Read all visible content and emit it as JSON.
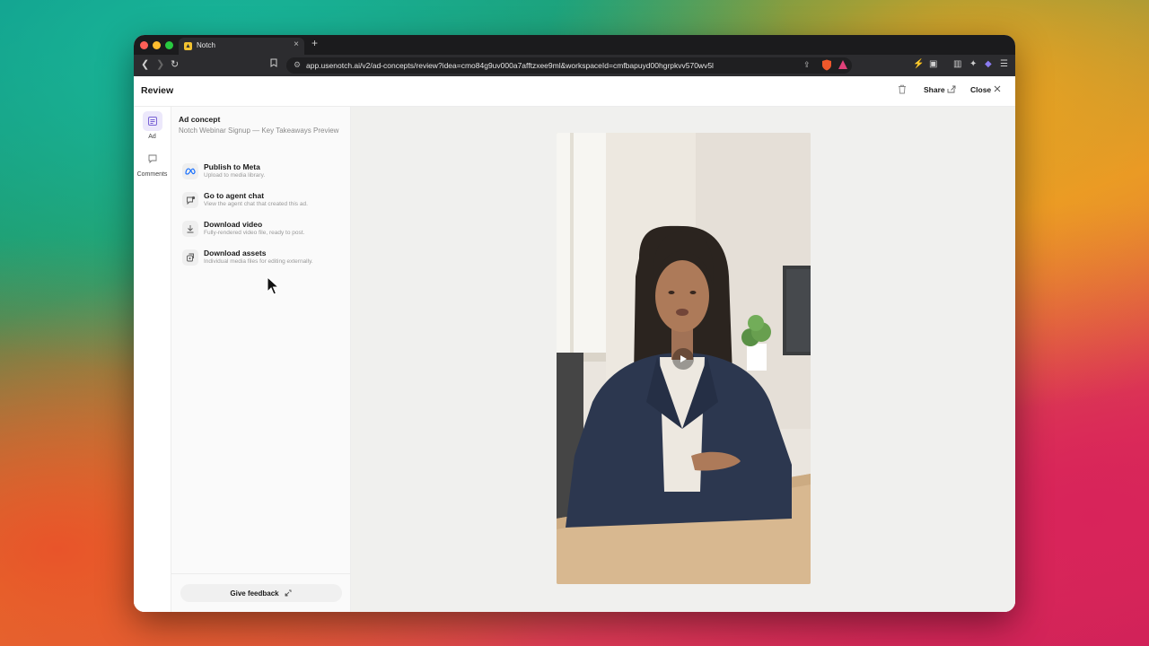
{
  "browser": {
    "tab_title": "Notch",
    "tab_close": "×",
    "new_tab": "+",
    "url": "app.usenotch.ai/v2/ad-concepts/review?idea=cmo84g9uv000a7afftzxee9ml&workspaceId=cmfbapuyd00hgrpkvv570wv5l"
  },
  "header": {
    "title": "Review",
    "share_label": "Share",
    "close_label": "Close"
  },
  "rail": {
    "items": [
      {
        "label": "Ad"
      },
      {
        "label": "Comments"
      }
    ]
  },
  "panel": {
    "concept_label": "Ad concept",
    "concept_name": "Notch Webinar Signup — Key Takeaways Preview",
    "actions": [
      {
        "title": "Publish to Meta",
        "subtitle": "Upload to media library."
      },
      {
        "title": "Go to agent chat",
        "subtitle": "View the agent chat that created this ad."
      },
      {
        "title": "Download video",
        "subtitle": "Fully-rendered video file, ready to post."
      },
      {
        "title": "Download assets",
        "subtitle": "Individual media files for editing externally."
      }
    ],
    "feedback_label": "Give feedback"
  },
  "colors": {
    "accent": "#7a64d6",
    "meta_blue": "#0866ff"
  }
}
